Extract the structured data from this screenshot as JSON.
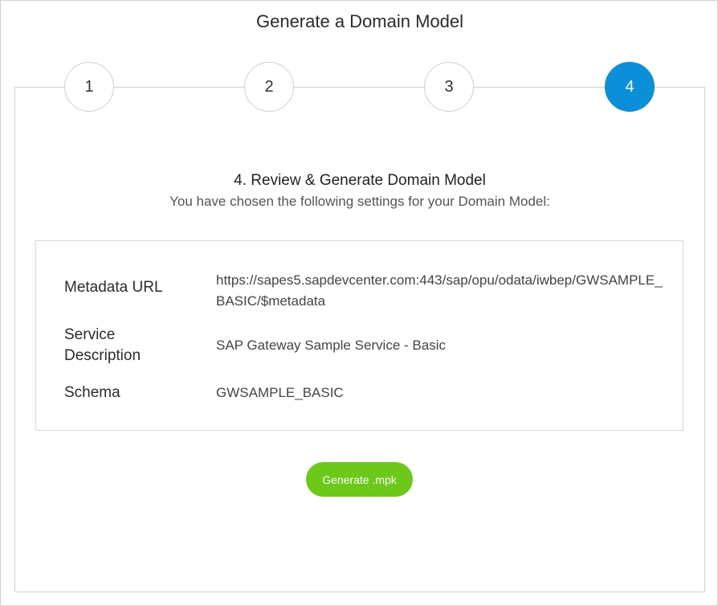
{
  "dialog": {
    "title": "Generate a Domain Model"
  },
  "wizard": {
    "steps": [
      {
        "label": "1",
        "active": false
      },
      {
        "label": "2",
        "active": false
      },
      {
        "label": "3",
        "active": false
      },
      {
        "label": "4",
        "active": true
      }
    ],
    "heading": "4. Review & Generate Domain Model",
    "subheading": "You have chosen the following settings for your Domain Model:"
  },
  "summary": {
    "fields": [
      {
        "label": "Metadata URL",
        "value": "https://sapes5.sapdevcenter.com:443/sap/opu/odata/iwbep/GWSAMPLE_BASIC/$metadata"
      },
      {
        "label": "Service Description",
        "value": "SAP Gateway Sample Service - Basic"
      },
      {
        "label": "Schema",
        "value": "GWSAMPLE_BASIC"
      }
    ]
  },
  "actions": {
    "generate_label": "Generate .mpk"
  },
  "colors": {
    "active_step": "#0a8fd8",
    "generate_button": "#6cc91a",
    "border": "#cfcfcf"
  }
}
